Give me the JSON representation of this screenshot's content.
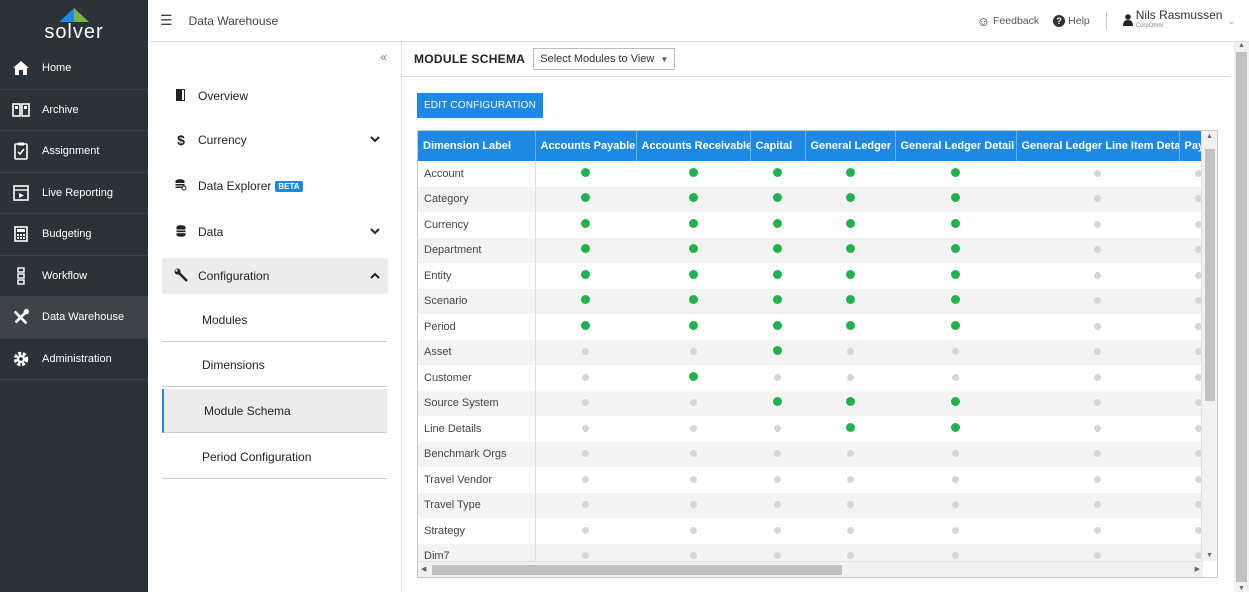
{
  "leftnav": {
    "logo": "solver",
    "items": [
      {
        "label": "Home",
        "icon": "home-icon"
      },
      {
        "label": "Archive",
        "icon": "archive-icon"
      },
      {
        "label": "Assignment",
        "icon": "clipboard-icon"
      },
      {
        "label": "Live Reporting",
        "icon": "report-icon"
      },
      {
        "label": "Budgeting",
        "icon": "calculator-icon"
      },
      {
        "label": "Workflow",
        "icon": "workflow-icon"
      },
      {
        "label": "Data Warehouse",
        "icon": "tools-icon"
      },
      {
        "label": "Administration",
        "icon": "gear-icon"
      }
    ]
  },
  "topbar": {
    "title": "Data Warehouse",
    "feedback": "Feedback",
    "help": "Help",
    "user_name": "Nils Rasmussen",
    "user_org": "CorpOmni"
  },
  "subpanel": {
    "collapse": "«",
    "overview": "Overview",
    "currency": "Currency",
    "data_explorer": "Data Explorer",
    "beta": "BETA",
    "data": "Data",
    "configuration": "Configuration",
    "sub_items": [
      "Modules",
      "Dimensions",
      "Module Schema",
      "Period Configuration"
    ]
  },
  "main": {
    "title": "MODULE SCHEMA",
    "select_placeholder": "Select Modules to View",
    "edit_button": "EDIT CONFIGURATION"
  },
  "grid": {
    "columns": [
      "Dimension Label",
      "Accounts Payable",
      "Accounts Receivable",
      "Capital",
      "General Ledger",
      "General Ledger Detail",
      "General Ledger Line Item Detail",
      "Pay"
    ],
    "rows": [
      {
        "label": "Account",
        "cells": [
          1,
          1,
          1,
          1,
          1,
          0,
          0
        ]
      },
      {
        "label": "Category",
        "cells": [
          1,
          1,
          1,
          1,
          1,
          0,
          0
        ]
      },
      {
        "label": "Currency",
        "cells": [
          1,
          1,
          1,
          1,
          1,
          0,
          0
        ]
      },
      {
        "label": "Department",
        "cells": [
          1,
          1,
          1,
          1,
          1,
          0,
          0
        ]
      },
      {
        "label": "Entity",
        "cells": [
          1,
          1,
          1,
          1,
          1,
          0,
          0
        ]
      },
      {
        "label": "Scenario",
        "cells": [
          1,
          1,
          1,
          1,
          1,
          0,
          0
        ]
      },
      {
        "label": "Period",
        "cells": [
          1,
          1,
          1,
          1,
          1,
          0,
          0
        ]
      },
      {
        "label": "Asset",
        "cells": [
          0,
          0,
          1,
          0,
          0,
          0,
          0
        ]
      },
      {
        "label": "Customer",
        "cells": [
          0,
          1,
          0,
          0,
          0,
          0,
          0
        ]
      },
      {
        "label": "Source System",
        "cells": [
          0,
          0,
          1,
          1,
          1,
          0,
          0
        ]
      },
      {
        "label": "Line Details",
        "cells": [
          0,
          0,
          0,
          1,
          1,
          0,
          0
        ]
      },
      {
        "label": "Benchmark Orgs",
        "cells": [
          0,
          0,
          0,
          0,
          0,
          0,
          0
        ]
      },
      {
        "label": "Travel Vendor",
        "cells": [
          0,
          0,
          0,
          0,
          0,
          0,
          0
        ]
      },
      {
        "label": "Travel Type",
        "cells": [
          0,
          0,
          0,
          0,
          0,
          0,
          0
        ]
      },
      {
        "label": "Strategy",
        "cells": [
          0,
          0,
          0,
          0,
          0,
          0,
          0
        ]
      },
      {
        "label": "Dim7",
        "cells": [
          0,
          0,
          0,
          0,
          0,
          0,
          0
        ]
      }
    ]
  },
  "colors": {
    "accent": "#1e88e5",
    "on": "#22b14c",
    "off": "#d6d6d6",
    "nav_bg": "#2c3338"
  }
}
